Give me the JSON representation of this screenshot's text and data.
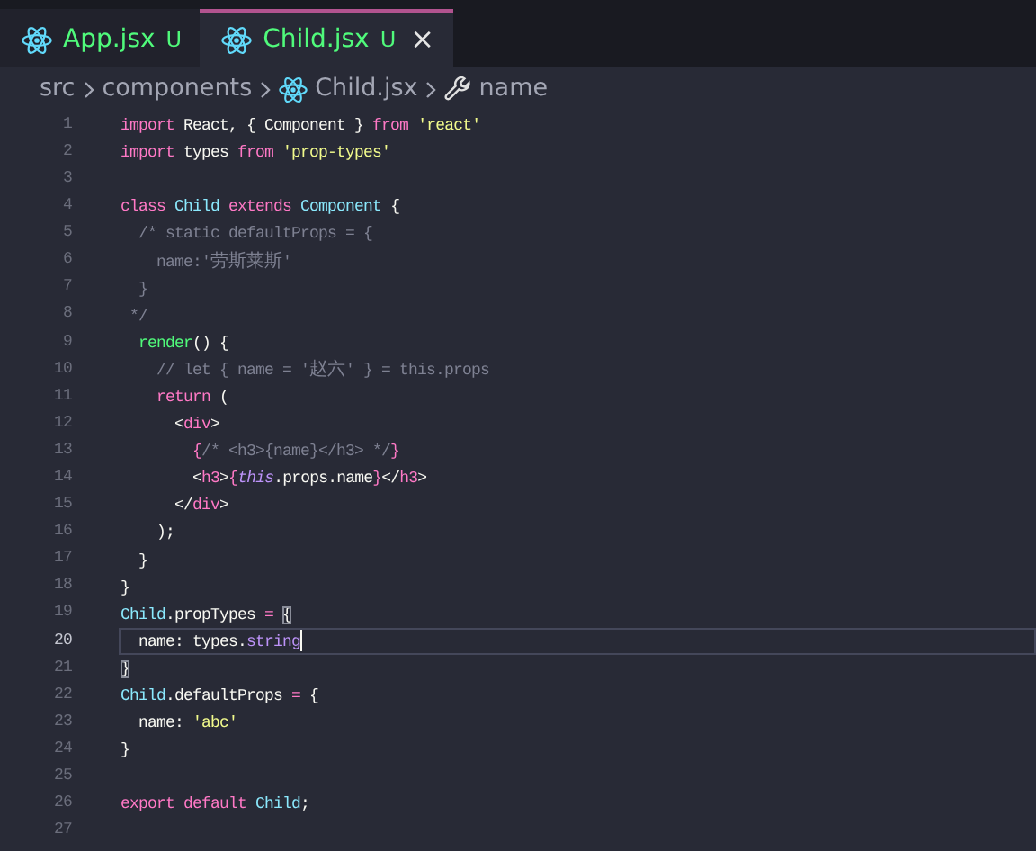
{
  "tabs": [
    {
      "label": "App.jsx",
      "status": "U",
      "selected": false
    },
    {
      "label": "Child.jsx",
      "status": "U",
      "selected": true,
      "close": "×"
    }
  ],
  "breadcrumb": [
    {
      "label": "src",
      "kind": "folder"
    },
    {
      "label": "components",
      "kind": "folder"
    },
    {
      "label": "Child.jsx",
      "kind": "file"
    },
    {
      "label": "name",
      "kind": "symbol"
    }
  ],
  "lines": [
    {
      "number": "1",
      "current": false,
      "tokens": [
        {
          "kind": "kw",
          "text": "import"
        },
        {
          "kind": "pl",
          "text": " React, { Component } "
        },
        {
          "kind": "kw",
          "text": "from"
        },
        {
          "kind": "str",
          "text": " 'react'"
        }
      ]
    },
    {
      "number": "2",
      "current": false,
      "tokens": [
        {
          "kind": "kw",
          "text": "import"
        },
        {
          "kind": "pl",
          "text": " types "
        },
        {
          "kind": "kw",
          "text": "from"
        },
        {
          "kind": "str",
          "text": " 'prop-types'"
        }
      ]
    },
    {
      "number": "3",
      "current": false
    },
    {
      "number": "4",
      "current": false,
      "tokens": [
        {
          "kind": "kw",
          "text": "class"
        },
        {
          "kind": "cls",
          "text": " Child"
        },
        {
          "kind": "kw",
          "text": " extends"
        },
        {
          "kind": "cls",
          "text": " Component"
        },
        {
          "kind": "pl",
          "text": " {"
        }
      ]
    },
    {
      "number": "5",
      "current": false,
      "tokens": [
        {
          "kind": "cm",
          "text": "  /* static defaultProps = {"
        }
      ]
    },
    {
      "number": "6",
      "current": false,
      "tokens": [
        {
          "kind": "cm",
          "text": "    name:'"
        },
        {
          "kind": "cjk",
          "text": "劳斯莱斯"
        },
        {
          "kind": "cm",
          "text": "'"
        }
      ]
    },
    {
      "number": "7",
      "current": false,
      "tokens": [
        {
          "kind": "cm",
          "text": "  }"
        }
      ]
    },
    {
      "number": "8",
      "current": false,
      "tokens": [
        {
          "kind": "cm",
          "text": " */"
        }
      ]
    },
    {
      "number": "9",
      "current": false,
      "tokens": [
        {
          "kind": "fn",
          "text": "  render"
        },
        {
          "kind": "pl",
          "text": "() {"
        }
      ]
    },
    {
      "number": "10",
      "current": false,
      "tokens": [
        {
          "kind": "cm",
          "text": "    // let { name = '"
        },
        {
          "kind": "cjk",
          "text": "赵六"
        },
        {
          "kind": "cm",
          "text": "' } = this.props"
        }
      ]
    },
    {
      "number": "11",
      "current": false,
      "tokens": [
        {
          "kind": "kw",
          "text": "    return"
        },
        {
          "kind": "pl",
          "text": " ("
        }
      ]
    },
    {
      "number": "12",
      "current": false,
      "tokens": [
        {
          "kind": "pl",
          "text": "      <"
        },
        {
          "kind": "tag",
          "text": "div"
        },
        {
          "kind": "pl",
          "text": ">"
        }
      ]
    },
    {
      "number": "13",
      "current": false,
      "tokens": [
        {
          "kind": "kw",
          "text": "        {"
        },
        {
          "kind": "cm",
          "text": "/* <h3>{name}</h3> */"
        },
        {
          "kind": "kw",
          "text": "}"
        }
      ]
    },
    {
      "number": "14",
      "current": false,
      "tokens": [
        {
          "kind": "pl",
          "text": "        <"
        },
        {
          "kind": "tag",
          "text": "h3"
        },
        {
          "kind": "pl",
          "text": ">"
        },
        {
          "kind": "kw",
          "text": "{"
        },
        {
          "kind": "it",
          "text": "this"
        },
        {
          "kind": "pl",
          "text": ".props.name"
        },
        {
          "kind": "kw",
          "text": "}"
        },
        {
          "kind": "pl",
          "text": "</"
        },
        {
          "kind": "tag",
          "text": "h3"
        },
        {
          "kind": "pl",
          "text": ">"
        }
      ]
    },
    {
      "number": "15",
      "current": false,
      "tokens": [
        {
          "kind": "pl",
          "text": "      </"
        },
        {
          "kind": "tag",
          "text": "div"
        },
        {
          "kind": "pl",
          "text": ">"
        }
      ]
    },
    {
      "number": "16",
      "current": false,
      "tokens": [
        {
          "kind": "pl",
          "text": "    );"
        }
      ]
    },
    {
      "number": "17",
      "current": false,
      "tokens": [
        {
          "kind": "pl",
          "text": "  }"
        }
      ]
    },
    {
      "number": "18",
      "current": false,
      "tokens": [
        {
          "kind": "pl",
          "text": "}"
        }
      ]
    },
    {
      "number": "19",
      "current": false,
      "tokens": [
        {
          "kind": "cls",
          "text": "Child"
        },
        {
          "kind": "pl",
          "text": ".propTypes "
        },
        {
          "kind": "kw",
          "text": "= "
        },
        {
          "kind": "bm",
          "text": "{"
        }
      ]
    },
    {
      "number": "20",
      "current": true,
      "tokens": [
        {
          "kind": "pl",
          "text": "  name: types."
        },
        {
          "kind": "prop",
          "text": "string"
        }
      ]
    },
    {
      "number": "21",
      "current": false,
      "tokens": [
        {
          "kind": "bm",
          "text": "}"
        }
      ]
    },
    {
      "number": "22",
      "current": false,
      "tokens": [
        {
          "kind": "cls",
          "text": "Child"
        },
        {
          "kind": "pl",
          "text": ".defaultProps "
        },
        {
          "kind": "kw",
          "text": "="
        },
        {
          "kind": "pl",
          "text": " {"
        }
      ]
    },
    {
      "number": "23",
      "current": false,
      "tokens": [
        {
          "kind": "pl",
          "text": "  name: "
        },
        {
          "kind": "str",
          "text": "'abc'"
        }
      ]
    },
    {
      "number": "24",
      "current": false,
      "tokens": [
        {
          "kind": "pl",
          "text": "}"
        }
      ]
    },
    {
      "number": "25",
      "current": false
    },
    {
      "number": "26",
      "current": false,
      "tokens": [
        {
          "kind": "kw",
          "text": "export default"
        },
        {
          "kind": "cls",
          "text": " Child"
        },
        {
          "kind": "pl",
          "text": ";"
        }
      ]
    },
    {
      "number": "27",
      "current": false
    }
  ]
}
